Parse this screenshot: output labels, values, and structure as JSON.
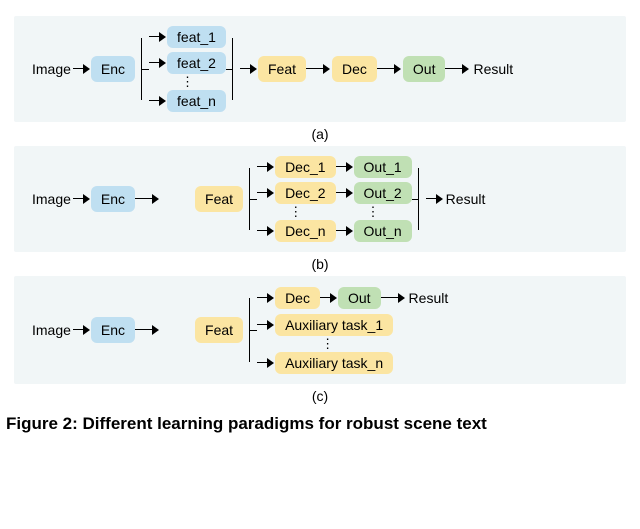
{
  "panel_a": {
    "image": "Image",
    "enc": "Enc",
    "feats": [
      "feat_1",
      "feat_2",
      "feat_n"
    ],
    "feat": "Feat",
    "dec": "Dec",
    "out": "Out",
    "result": "Result",
    "label": "(a)"
  },
  "panel_b": {
    "image": "Image",
    "enc": "Enc",
    "feat": "Feat",
    "decs": [
      "Dec_1",
      "Dec_2",
      "Dec_n"
    ],
    "outs": [
      "Out_1",
      "Out_2",
      "Out_n"
    ],
    "result": "Result",
    "label": "(b)"
  },
  "panel_c": {
    "image": "Image",
    "enc": "Enc",
    "feat": "Feat",
    "dec": "Dec",
    "out": "Out",
    "result": "Result",
    "aux": [
      "Auxiliary task_1",
      "Auxiliary task_n"
    ],
    "label": "(c)"
  },
  "figure_caption": "Figure 2: Different learning paradigms for robust scene text"
}
